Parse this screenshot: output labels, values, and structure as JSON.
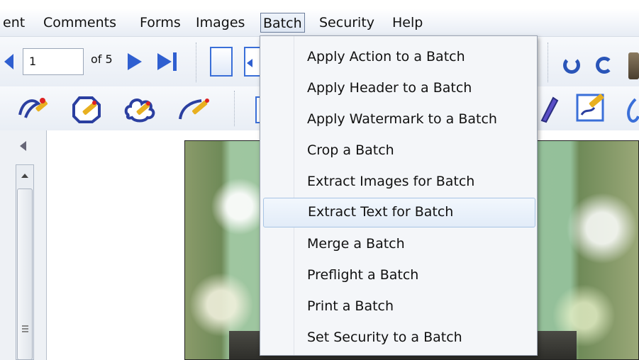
{
  "menubar": {
    "items": [
      "ent",
      "Comments",
      "Forms",
      "Images",
      "Batch",
      "Security",
      "Help"
    ],
    "active": "Batch"
  },
  "navigation": {
    "page_value": "1",
    "page_of": "of 5"
  },
  "batch_menu": {
    "items": [
      "Apply Action to a Batch",
      "Apply Header to a Batch",
      "Apply Watermark to a Batch",
      "Crop a Batch",
      "Extract Images for Batch",
      "Extract Text for Batch",
      "Merge a Batch",
      "Preflight a Batch",
      "Print a Batch",
      "Set Security to a Batch"
    ],
    "highlighted": "Extract Text for Batch"
  },
  "icons": {
    "prev_page": "prev-page-icon",
    "next_page": "next-page-icon",
    "last_page": "last-page-icon",
    "rotate_ccw": "rotate-ccw-icon",
    "rotate_cw": "rotate-cw-icon"
  },
  "colors": {
    "nav_arrow": "#2f5fd0",
    "menu_highlight_border": "#a8c4e4",
    "toolbar_bg": "#eef2f7"
  }
}
